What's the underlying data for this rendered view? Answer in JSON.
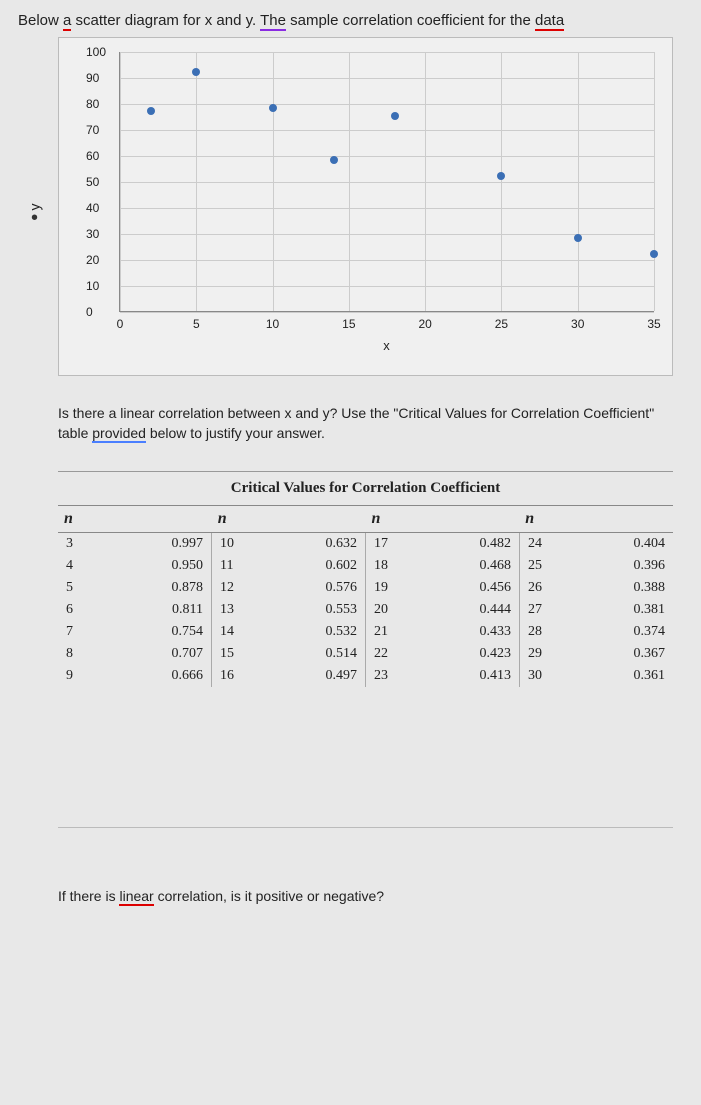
{
  "intro": {
    "prefix": "Below",
    "underlined1": "a",
    "mid1": " scatter diagram for x and y",
    "underlined2": "The",
    "mid2": " sample correlation coefficient for the ",
    "underlined3": "data"
  },
  "chart_data": {
    "type": "scatter",
    "xlabel": "x",
    "ylabel": "y",
    "xlim": [
      0,
      35
    ],
    "ylim": [
      0,
      100
    ],
    "xticks": [
      0,
      5,
      10,
      15,
      20,
      25,
      30,
      35
    ],
    "yticks": [
      0,
      10,
      20,
      30,
      40,
      50,
      60,
      70,
      80,
      90,
      100
    ],
    "series": [
      {
        "name": "data",
        "points": [
          {
            "x": 2,
            "y": 77
          },
          {
            "x": 5,
            "y": 92
          },
          {
            "x": 10,
            "y": 78
          },
          {
            "x": 14,
            "y": 58
          },
          {
            "x": 18,
            "y": 75
          },
          {
            "x": 25,
            "y": 52
          },
          {
            "x": 30,
            "y": 28
          },
          {
            "x": 35,
            "y": 22
          }
        ]
      }
    ]
  },
  "question": {
    "text1": "Is there a linear correlation between x and y? Use the \"Critical Values for Correlation Coefficient\" table ",
    "underlined": "provided",
    "text2": " below to justify your answer."
  },
  "cv_title": "Critical Values for Correlation Coefficient",
  "cv_header": "n",
  "cv_table": [
    [
      {
        "n": "3",
        "v": "0.997"
      },
      {
        "n": "4",
        "v": "0.950"
      },
      {
        "n": "5",
        "v": "0.878"
      },
      {
        "n": "6",
        "v": "0.811"
      },
      {
        "n": "7",
        "v": "0.754"
      },
      {
        "n": "8",
        "v": "0.707"
      },
      {
        "n": "9",
        "v": "0.666"
      }
    ],
    [
      {
        "n": "10",
        "v": "0.632"
      },
      {
        "n": "11",
        "v": "0.602"
      },
      {
        "n": "12",
        "v": "0.576"
      },
      {
        "n": "13",
        "v": "0.553"
      },
      {
        "n": "14",
        "v": "0.532"
      },
      {
        "n": "15",
        "v": "0.514"
      },
      {
        "n": "16",
        "v": "0.497"
      }
    ],
    [
      {
        "n": "17",
        "v": "0.482"
      },
      {
        "n": "18",
        "v": "0.468"
      },
      {
        "n": "19",
        "v": "0.456"
      },
      {
        "n": "20",
        "v": "0.444"
      },
      {
        "n": "21",
        "v": "0.433"
      },
      {
        "n": "22",
        "v": "0.423"
      },
      {
        "n": "23",
        "v": "0.413"
      }
    ],
    [
      {
        "n": "24",
        "v": "0.404"
      },
      {
        "n": "25",
        "v": "0.396"
      },
      {
        "n": "26",
        "v": "0.388"
      },
      {
        "n": "27",
        "v": "0.381"
      },
      {
        "n": "28",
        "v": "0.374"
      },
      {
        "n": "29",
        "v": "0.367"
      },
      {
        "n": "30",
        "v": "0.361"
      }
    ]
  ],
  "followup": {
    "text1": "If there is ",
    "underlined": "linear",
    "text2": " correlation, is it positive or negative?"
  }
}
